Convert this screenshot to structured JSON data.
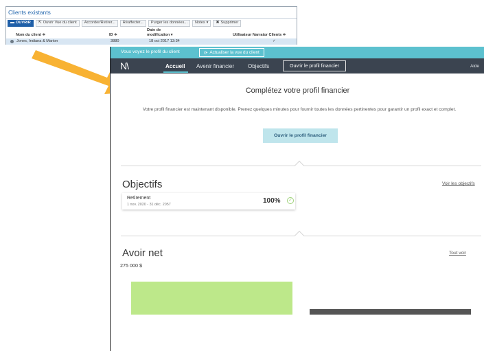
{
  "clients_panel": {
    "title": "Clients existants",
    "toolbar": [
      {
        "icon": "folder-icon",
        "glyph": "▬",
        "label": "OUVRIR",
        "primary": true
      },
      {
        "icon": "external-link-icon",
        "glyph": "⇱",
        "label": "Ouvrir Vue du client"
      },
      {
        "label": "Accorder/Retirer..."
      },
      {
        "label": "Réaffecter..."
      },
      {
        "label": "Purger les données..."
      },
      {
        "label": "Notes",
        "dropdown": "▾"
      },
      {
        "icon": "close-icon",
        "glyph": "✖",
        "label": "Supprimer"
      }
    ],
    "columns": {
      "name": "Nom du client ≑",
      "id": "ID ≑",
      "date_line1": "Date de",
      "date_line2": "modification ▾",
      "user": "Utilisateur Narrator Clients ≑"
    },
    "row": {
      "name": "Jones, Indiana & Marion",
      "id": "3880",
      "date": "18 oct 2017 13:34",
      "check": "✓"
    }
  },
  "app": {
    "banner": {
      "text": "Vous voyez le profil du client",
      "refresh_icon": "⟳",
      "refresh_label": "Actualiser la vue du client"
    },
    "nav": {
      "logo": "N\\",
      "items": [
        "Accueil",
        "Avenir financier",
        "Objectifs"
      ],
      "open_profile": "Ouvrir le profil financier",
      "help": "Aide"
    },
    "profile": {
      "title": "Complétez votre profil financier",
      "description": "Votre profil financier est maintenant disponible. Prenez quelques minutes pour fournir toutes les données pertinentes pour garantir un profil exact et complet.",
      "button": "Ouvrir le profil financier"
    },
    "goals": {
      "title": "Objectifs",
      "link": "Voir les objectifs",
      "card": {
        "name": "Retirement",
        "dates": "1 nov. 2020 - 31 déc. 2057",
        "percent": "100%",
        "status_icon": "✓"
      }
    },
    "networth": {
      "title": "Avoir net",
      "link": "Tout voir",
      "value": "275 000 $"
    }
  },
  "colors": {
    "banner": "#5cc1cf",
    "nav": "#3b4450",
    "assets_bar": "#bde88a",
    "liabilities_bar": "#555555",
    "arrow": "#f8b233",
    "primary_button": "#1f5fa8"
  },
  "chart_data": {
    "type": "bar",
    "categories": [
      "",
      ""
    ],
    "values": [
      1,
      0.1
    ],
    "title": "",
    "xlabel": "",
    "ylabel": ""
  }
}
